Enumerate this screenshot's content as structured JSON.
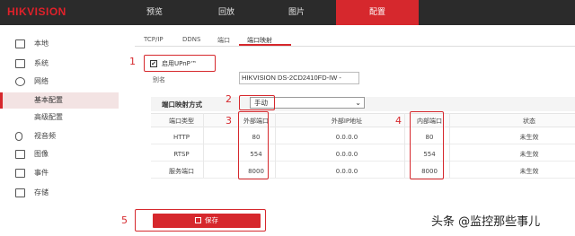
{
  "brand": {
    "logo": "HIKVISION",
    "accent": "#d6282d"
  },
  "nav": {
    "items": [
      {
        "label": "预览"
      },
      {
        "label": "回放"
      },
      {
        "label": "图片"
      },
      {
        "label": "配置"
      }
    ]
  },
  "sidebar": {
    "items": [
      {
        "label": "本地",
        "icon": "monitor-icon"
      },
      {
        "label": "系统",
        "icon": "system-icon"
      },
      {
        "label": "网络",
        "icon": "globe-icon"
      },
      {
        "label": "基本配置",
        "icon": ""
      },
      {
        "label": "高级配置",
        "icon": ""
      },
      {
        "label": "视音频",
        "icon": "mic-icon"
      },
      {
        "label": "图像",
        "icon": "image-icon"
      },
      {
        "label": "事件",
        "icon": "calendar-icon"
      },
      {
        "label": "存储",
        "icon": "storage-icon"
      }
    ]
  },
  "tabs": [
    {
      "label": "TCP/IP"
    },
    {
      "label": "DDNS"
    },
    {
      "label": "端口"
    },
    {
      "label": "端口映射"
    }
  ],
  "form": {
    "upnp_label": "启用UPnP™",
    "upnp_checked": "✔",
    "alias_label": "别名",
    "alias_value": "HIKVISION DS-2CD2410FD-IW -",
    "mode_label": "端口映射方式",
    "mode_value": "手动"
  },
  "table": {
    "headers": [
      "端口类型",
      "外部端口",
      "外部IP地址",
      "内部端口",
      "状态"
    ],
    "rows": [
      [
        "HTTP",
        "80",
        "0.0.0.0",
        "80",
        "未生效"
      ],
      [
        "RTSP",
        "554",
        "0.0.0.0",
        "554",
        "未生效"
      ],
      [
        "服务端口",
        "8000",
        "0.0.0.0",
        "8000",
        "未生效"
      ]
    ]
  },
  "save_label": "保存",
  "annotations": [
    "1",
    "2",
    "3",
    "4",
    "5"
  ],
  "watermark": "头条 @监控那些事儿"
}
